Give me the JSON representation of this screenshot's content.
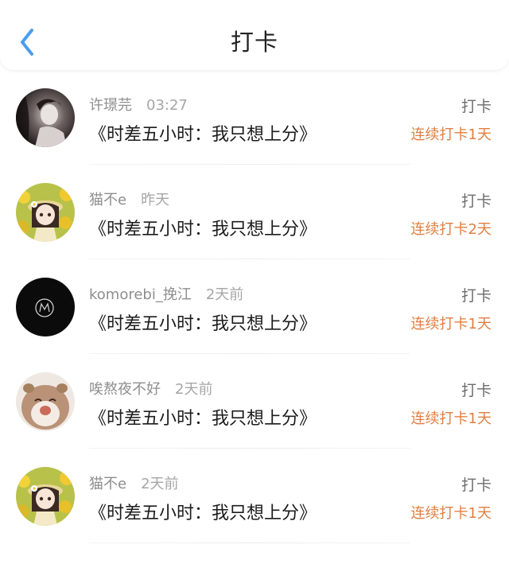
{
  "header": {
    "title": "打卡",
    "back_icon": "chevron-left-icon",
    "accent": "#4a9df0"
  },
  "entries": [
    {
      "user": "许璟芫",
      "time": "03:27",
      "book": "《时差五小时：我只想上分》",
      "action": "打卡",
      "streak": "连续打卡1天",
      "avatar": "photo-avatar-woman"
    },
    {
      "user": "猫不e",
      "time": "昨天",
      "book": "《时差五小时：我只想上分》",
      "action": "打卡",
      "streak": "连续打卡2天",
      "avatar": "anime-girl-sunflower-avatar"
    },
    {
      "user": "komorebi_挽江",
      "time": "2天前",
      "book": "《时差五小时：我只想上分》",
      "action": "打卡",
      "streak": "连续打卡1天",
      "avatar": "black-circle-logo-avatar"
    },
    {
      "user": "唉熬夜不好",
      "time": "2天前",
      "book": "《时差五小时：我只想上分》",
      "action": "打卡",
      "streak": "连续打卡1天",
      "avatar": "hamster-avatar"
    },
    {
      "user": "猫不e",
      "time": "2天前",
      "book": "《时差五小时：我只想上分》",
      "action": "打卡",
      "streak": "连续打卡1天",
      "avatar": "anime-girl-sunflower-avatar"
    }
  ],
  "colors": {
    "streak": "#e07f40",
    "username": "#8e8e8e",
    "title": "#1c1c1c"
  }
}
